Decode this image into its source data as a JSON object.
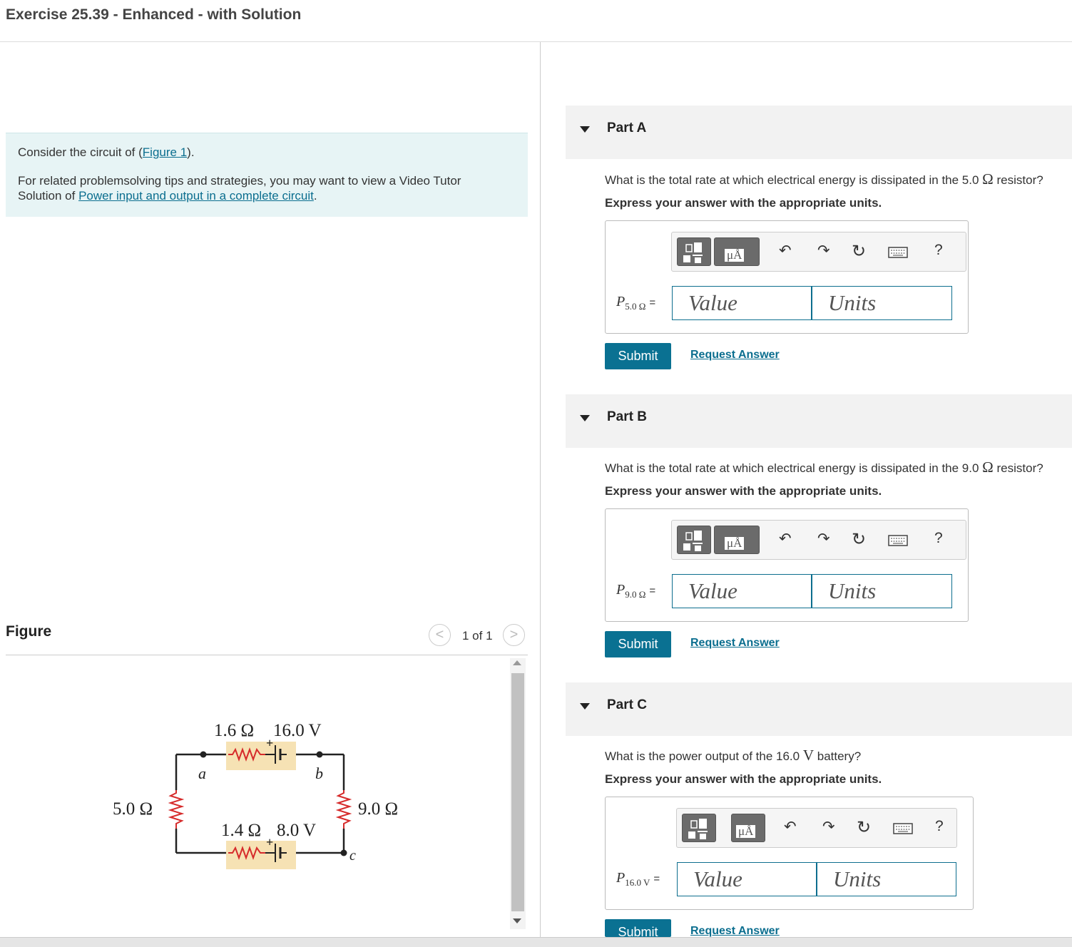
{
  "title": "Exercise 25.39 - Enhanced - with Solution",
  "intro": {
    "line1_pre": "Consider the circuit of (",
    "line1_link": "Figure 1",
    "line1_post": ").",
    "line2_a": "For related problemsolving tips and strategies, you may want to view a Video Tutor",
    "line2_b_pre": "Solution of ",
    "line2_link": "Power input and output in a complete circuit",
    "line2_post": "."
  },
  "figure": {
    "label": "Figure",
    "pager": {
      "prev": "<",
      "count": "1 of 1",
      "next": ">"
    },
    "circuit": {
      "top_resistor": "1.6 Ω",
      "top_battery": "16.0 V",
      "bottom_resistor": "1.4 Ω",
      "bottom_battery": "8.0 V",
      "left_resistor": "5.0 Ω",
      "right_resistor": "9.0 Ω",
      "node_a": "a",
      "node_b": "b",
      "node_c": "c",
      "plus": "+"
    }
  },
  "parts": [
    {
      "title": "Part A",
      "question_pre": "What is the total rate at which electrical energy is dissipated in the 5.0 ",
      "question_unit": "Ω",
      "question_post": " resistor?",
      "instruction": "Express your answer with the appropriate units.",
      "var": "P",
      "sub": "5.0 Ω",
      "eq": "=",
      "value_placeholder": "Value",
      "units_placeholder": "Units",
      "submit": "Submit",
      "request": "Request Answer"
    },
    {
      "title": "Part B",
      "question_pre": "What is the total rate at which electrical energy is dissipated in the 9.0 ",
      "question_unit": "Ω",
      "question_post": " resistor?",
      "instruction": "Express your answer with the appropriate units.",
      "var": "P",
      "sub": "9.0 Ω",
      "eq": "=",
      "value_placeholder": "Value",
      "units_placeholder": "Units",
      "submit": "Submit",
      "request": "Request Answer"
    },
    {
      "title": "Part C",
      "question_pre": "What is the power output of the 16.0 ",
      "question_unit": "V",
      "question_post": " battery?",
      "instruction": "Express your answer with the appropriate units.",
      "var": "P",
      "sub": "16.0 V",
      "eq": "=",
      "value_placeholder": "Value",
      "units_placeholder": "Units",
      "submit": "Submit",
      "request": "Request Answer"
    }
  ],
  "toolbar": {
    "units_btn": "μÅ",
    "help": "?"
  }
}
